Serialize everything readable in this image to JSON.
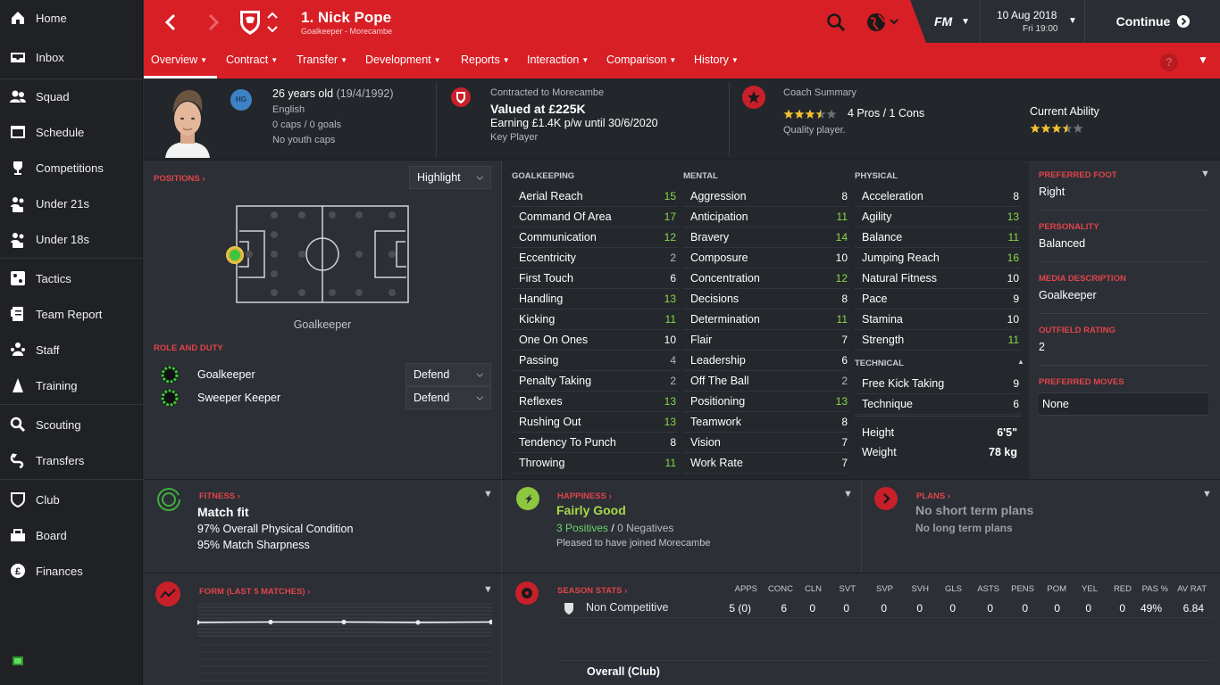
{
  "sidebar": {
    "items": [
      {
        "label": "Home",
        "icon": "home-icon"
      },
      {
        "label": "Inbox",
        "icon": "inbox-icon"
      },
      {
        "label": "Squad",
        "icon": "squad-icon"
      },
      {
        "label": "Schedule",
        "icon": "schedule-icon"
      },
      {
        "label": "Competitions",
        "icon": "trophy-icon"
      },
      {
        "label": "Under 21s",
        "icon": "u21-icon"
      },
      {
        "label": "Under 18s",
        "icon": "u18-icon"
      },
      {
        "label": "Tactics",
        "icon": "tactics-icon"
      },
      {
        "label": "Team Report",
        "icon": "team-report-icon"
      },
      {
        "label": "Staff",
        "icon": "staff-icon"
      },
      {
        "label": "Training",
        "icon": "training-icon"
      },
      {
        "label": "Scouting",
        "icon": "scouting-icon"
      },
      {
        "label": "Transfers",
        "icon": "transfers-icon"
      },
      {
        "label": "Club",
        "icon": "club-icon"
      },
      {
        "label": "Board",
        "icon": "board-icon"
      },
      {
        "label": "Finances",
        "icon": "finances-icon"
      }
    ]
  },
  "header": {
    "title": "1. Nick Pope",
    "subtitle": "Goalkeeper - Morecambe",
    "fm_label": "FM",
    "date": "10 Aug 2018",
    "day_time": "Fri 19:00",
    "continue_label": "Continue",
    "help_label": "?",
    "accent": "#d81f26"
  },
  "tabs": [
    {
      "label": "Overview"
    },
    {
      "label": "Contract"
    },
    {
      "label": "Transfer"
    },
    {
      "label": "Development"
    },
    {
      "label": "Reports"
    },
    {
      "label": "Interaction"
    },
    {
      "label": "Comparison"
    },
    {
      "label": "History"
    }
  ],
  "profile": {
    "hg_badge": "HG",
    "age": "26 years old",
    "dob": "(19/4/1992)",
    "nationality": "English",
    "caps": "0 caps / 0 goals",
    "youth_caps": "No youth caps",
    "contract_label": "Contracted to Morecambe",
    "value": "Valued at £225K",
    "earning": "Earning £1.4K p/w until 30/6/2020",
    "status": "Key Player",
    "coach_title": "Coach Summary",
    "pros_cons": "4 Pros / 1 Cons",
    "coach_stars": 3.5,
    "quality": "Quality player.",
    "current_ability_label": "Current Ability",
    "ability_stars": 3.5
  },
  "positions": {
    "title": "POSITIONS",
    "highlight_label": "Highlight",
    "position_label": "Goalkeeper",
    "role_title": "ROLE AND DUTY",
    "roles": [
      {
        "name": "Goalkeeper",
        "duty": "Defend"
      },
      {
        "name": "Sweeper Keeper",
        "duty": "Defend"
      }
    ]
  },
  "attributes": {
    "goalkeeping_title": "GOALKEEPING",
    "mental_title": "MENTAL",
    "physical_title": "PHYSICAL",
    "technical_title": "TECHNICAL",
    "goalkeeping": [
      {
        "name": "Aerial Reach",
        "value": "15",
        "color": "green"
      },
      {
        "name": "Command Of Area",
        "value": "17",
        "color": "green"
      },
      {
        "name": "Communication",
        "value": "12",
        "color": "green"
      },
      {
        "name": "Eccentricity",
        "value": "2",
        "color": "grey"
      },
      {
        "name": "First Touch",
        "value": "6",
        "color": "white"
      },
      {
        "name": "Handling",
        "value": "13",
        "color": "green"
      },
      {
        "name": "Kicking",
        "value": "11",
        "color": "green"
      },
      {
        "name": "One On Ones",
        "value": "10",
        "color": "white"
      },
      {
        "name": "Passing",
        "value": "4",
        "color": "grey"
      },
      {
        "name": "Penalty Taking",
        "value": "2",
        "color": "grey"
      },
      {
        "name": "Reflexes",
        "value": "13",
        "color": "green"
      },
      {
        "name": "Rushing Out",
        "value": "13",
        "color": "green"
      },
      {
        "name": "Tendency To Punch",
        "value": "8",
        "color": "white"
      },
      {
        "name": "Throwing",
        "value": "11",
        "color": "green"
      }
    ],
    "mental": [
      {
        "name": "Aggression",
        "value": "8",
        "color": "white"
      },
      {
        "name": "Anticipation",
        "value": "11",
        "color": "green"
      },
      {
        "name": "Bravery",
        "value": "14",
        "color": "green"
      },
      {
        "name": "Composure",
        "value": "10",
        "color": "white"
      },
      {
        "name": "Concentration",
        "value": "12",
        "color": "green"
      },
      {
        "name": "Decisions",
        "value": "8",
        "color": "white"
      },
      {
        "name": "Determination",
        "value": "11",
        "color": "green"
      },
      {
        "name": "Flair",
        "value": "7",
        "color": "white"
      },
      {
        "name": "Leadership",
        "value": "6",
        "color": "white"
      },
      {
        "name": "Off The Ball",
        "value": "2",
        "color": "grey"
      },
      {
        "name": "Positioning",
        "value": "13",
        "color": "green"
      },
      {
        "name": "Teamwork",
        "value": "8",
        "color": "white"
      },
      {
        "name": "Vision",
        "value": "7",
        "color": "white"
      },
      {
        "name": "Work Rate",
        "value": "7",
        "color": "white"
      }
    ],
    "physical": [
      {
        "name": "Acceleration",
        "value": "8",
        "color": "white"
      },
      {
        "name": "Agility",
        "value": "13",
        "color": "green"
      },
      {
        "name": "Balance",
        "value": "11",
        "color": "green"
      },
      {
        "name": "Jumping Reach",
        "value": "16",
        "color": "green"
      },
      {
        "name": "Natural Fitness",
        "value": "10",
        "color": "white"
      },
      {
        "name": "Pace",
        "value": "9",
        "color": "white"
      },
      {
        "name": "Stamina",
        "value": "10",
        "color": "white"
      },
      {
        "name": "Strength",
        "value": "11",
        "color": "green"
      }
    ],
    "technical": [
      {
        "name": "Free Kick Taking",
        "value": "9",
        "color": "white"
      },
      {
        "name": "Technique",
        "value": "6",
        "color": "white"
      }
    ],
    "height_label": "Height",
    "height": "6'5\"",
    "weight_label": "Weight",
    "weight": "78 kg"
  },
  "details": {
    "foot_label": "PREFERRED FOOT",
    "foot": "Right",
    "personality_label": "PERSONALITY",
    "personality": "Balanced",
    "media_label": "MEDIA DESCRIPTION",
    "media": "Goalkeeper",
    "outfield_label": "OUTFIELD RATING",
    "outfield": "2",
    "moves_label": "PREFERRED MOVES",
    "moves": "None"
  },
  "fitness": {
    "title": "FITNESS",
    "status": "Match fit",
    "condition": "97% Overall Physical Condition",
    "sharpness": "95% Match Sharpness"
  },
  "happiness": {
    "title": "HAPPINESS",
    "status": "Fairly Good",
    "positives": "3 Positives",
    "slash": "/",
    "negatives": "0 Negatives",
    "note": "Pleased to have joined Morecambe"
  },
  "plans": {
    "title": "PLANS",
    "short": "No short term plans",
    "long": "No long term plans"
  },
  "form": {
    "title": "FORM (LAST 5 MATCHES)",
    "ratings": [
      6.8,
      6.9,
      6.9,
      6.8,
      6.9
    ]
  },
  "season_stats": {
    "title": "SEASON STATS",
    "headers": [
      "APPS",
      "CONC",
      "CLN",
      "SVT",
      "SVP",
      "SVH",
      "GLS",
      "ASTS",
      "PENS",
      "POM",
      "YEL",
      "RED",
      "PAS %",
      "AV RAT"
    ],
    "row_label": "Non Competitive",
    "values": [
      "5 (0)",
      "6",
      "0",
      "0",
      "0",
      "0",
      "0",
      "0",
      "0",
      "0",
      "0",
      "0",
      "49%",
      "6.84"
    ],
    "footer_label": "Overall (Club)"
  }
}
